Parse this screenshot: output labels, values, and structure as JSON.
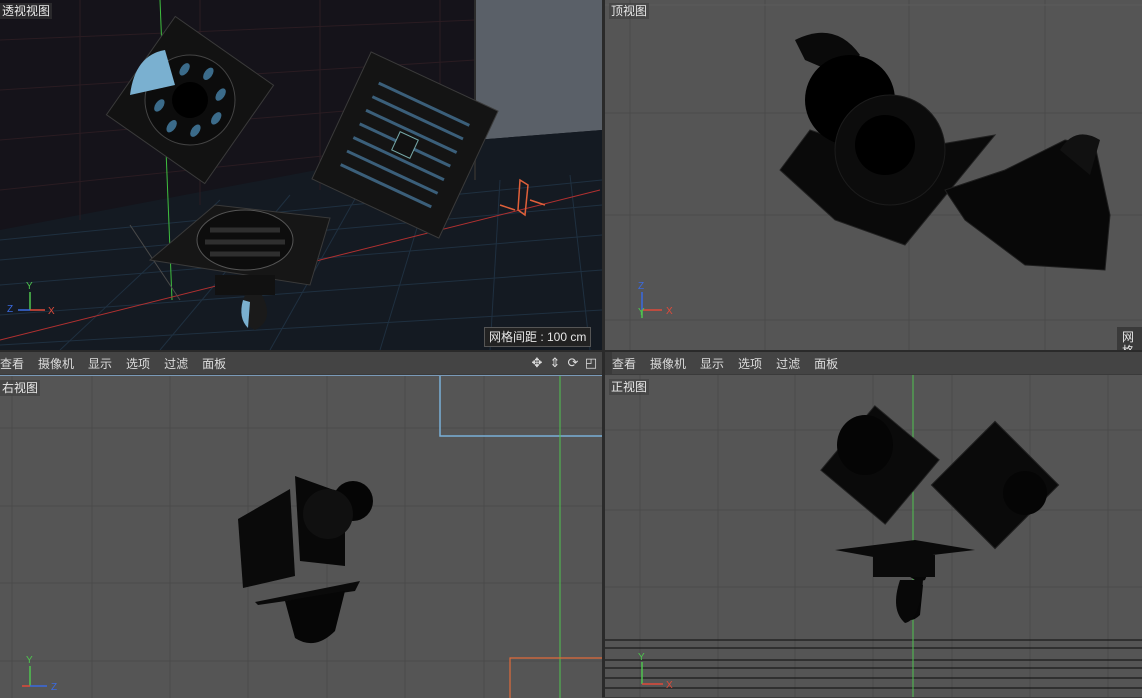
{
  "viewports": {
    "perspective": {
      "label": "透视视图",
      "grid_distance": "网格间距 : 100 cm"
    },
    "top": {
      "label": "顶视图",
      "grid_distance_partial": "网格"
    },
    "right": {
      "label": "右视图"
    },
    "front": {
      "label": "正视图"
    }
  },
  "menu_bar": {
    "items": [
      "查看",
      "摄像机",
      "显示",
      "选项",
      "过滤",
      "面板"
    ]
  },
  "axes": {
    "x": "X",
    "y": "Y",
    "z": "Z"
  },
  "colors": {
    "x_axis": "#e04a3a",
    "y_axis": "#4ec44e",
    "z_axis": "#3a6ae0",
    "viewport_bg": "#555555",
    "grid_line": "#4a4a4a",
    "toolbar_bg": "#444444"
  }
}
